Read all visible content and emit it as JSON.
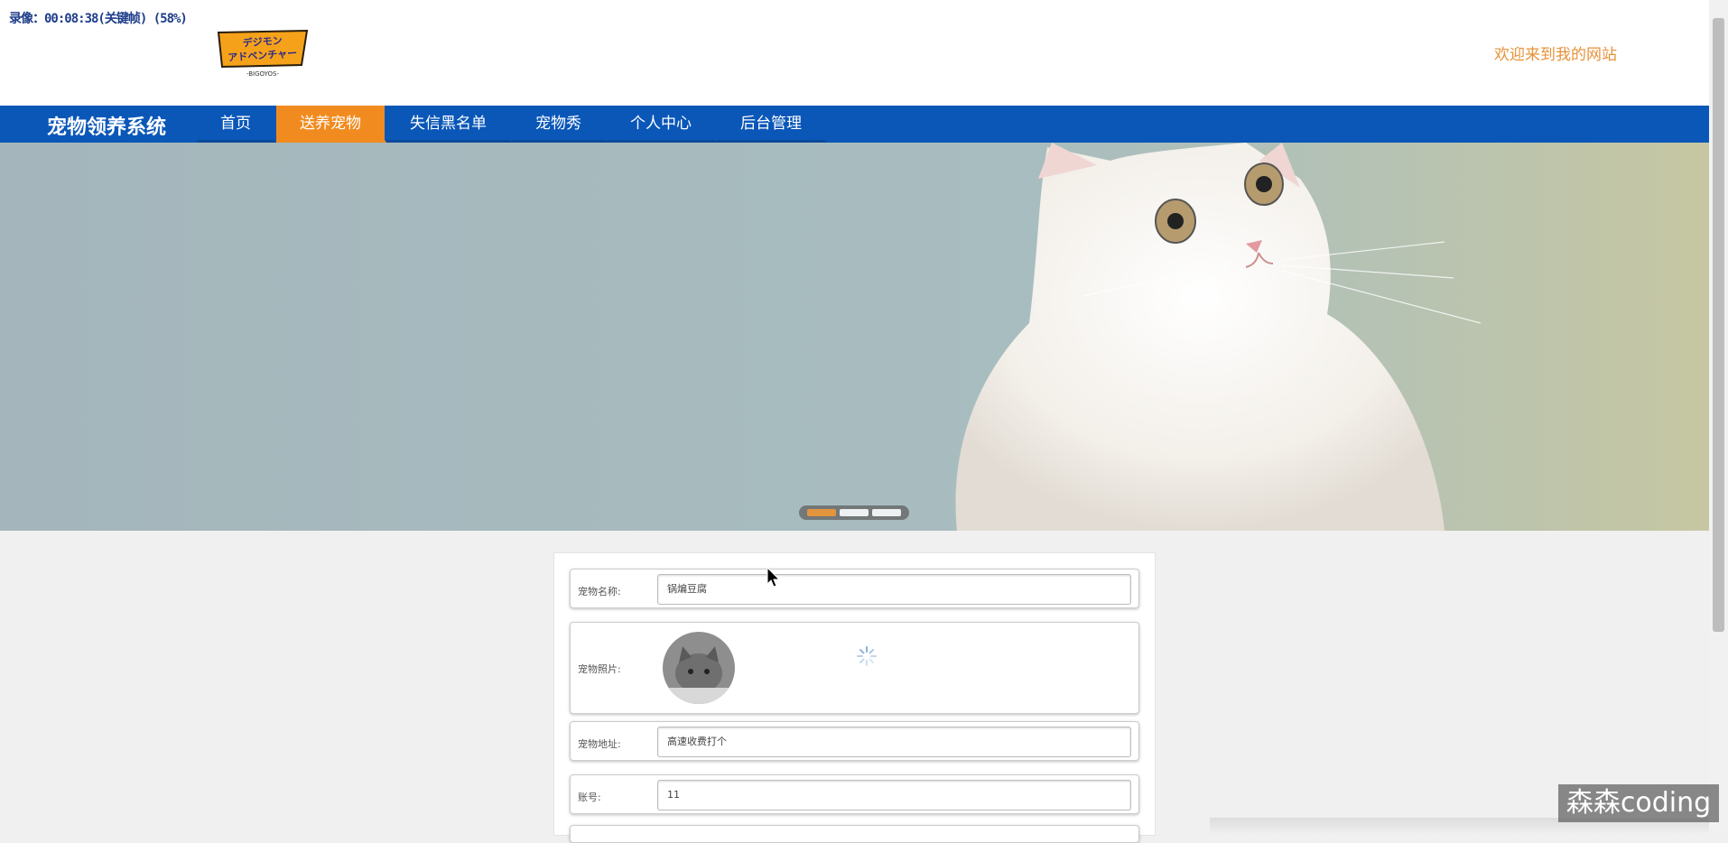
{
  "overlay": {
    "recording_text": "录像：00:08:38(关键帧) (58%)"
  },
  "header": {
    "logo_text": "デジモンアドベンチャー",
    "logo_sub": "-BIGOYOS-",
    "welcome": "欢迎来到我的网站"
  },
  "nav": {
    "brand": "宠物领养系统",
    "items": [
      {
        "label": "首页",
        "active": false
      },
      {
        "label": "送养宠物",
        "active": true
      },
      {
        "label": "失信黑名单",
        "active": false
      },
      {
        "label": "宠物秀",
        "active": false
      },
      {
        "label": "个人中心",
        "active": false
      },
      {
        "label": "后台管理",
        "active": false
      }
    ]
  },
  "banner": {
    "slides": 3,
    "active_slide": 1,
    "image": "white-kitten"
  },
  "form": {
    "name_label": "宠物名称:",
    "name_value": "锅煸豆腐",
    "photo_label": "宠物照片:",
    "address_label": "宠物地址:",
    "address_value": "高速收费打个",
    "account_label": "账号:",
    "account_value": "11"
  },
  "watermark": "森森coding",
  "colors": {
    "nav_bg": "#0a57b8",
    "nav_active": "#f28b1f",
    "welcome": "#e8923a"
  }
}
